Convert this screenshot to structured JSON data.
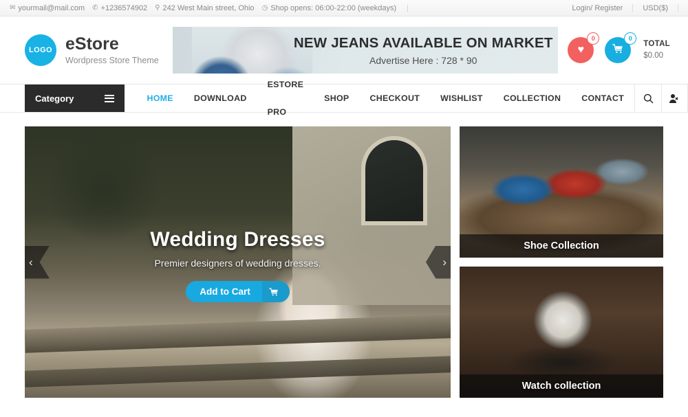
{
  "topbar": {
    "email": "yourmail@mail.com",
    "phone": "+1236574902",
    "address": "242 West Main street, Ohio",
    "hours": "Shop opens: 06:00-22:00 (weekdays)",
    "login": "Login/ Register",
    "currency": "USD($)",
    "icons": {
      "mail": "✉",
      "phone": "✆",
      "pin": "⚲",
      "clock": "◷"
    }
  },
  "header": {
    "logo_text": "LOGO",
    "brand_name": "eStore",
    "brand_tagline": "Wordpress Store Theme",
    "ad": {
      "title": "NEW JEANS AVAILABLE ON MARKET",
      "subtitle": "Advertise Here : 728 * 90"
    },
    "wishlist_count": "0",
    "cart_count": "0",
    "total_label": "TOTAL",
    "total_value": "$0.00",
    "colors": {
      "wishlist": "#f2605f",
      "cart": "#18aee0",
      "logo": "#18b2e5"
    }
  },
  "nav": {
    "category_label": "Category",
    "items": [
      {
        "label": "HOME",
        "active": true
      },
      {
        "label": "DOWNLOAD",
        "active": false
      },
      {
        "label": "ESTORE PRO",
        "active": false
      },
      {
        "label": "SHOP",
        "active": false
      },
      {
        "label": "CHECKOUT",
        "active": false
      },
      {
        "label": "WISHLIST",
        "active": false
      },
      {
        "label": "COLLECTION",
        "active": false
      },
      {
        "label": "CONTACT",
        "active": false
      }
    ],
    "active_color": "#1eb0e6"
  },
  "hero": {
    "title": "Wedding Dresses",
    "subtitle": "Premier designers of wedding dresses.",
    "button_label": "Add to Cart",
    "prev_arrow": "‹",
    "next_arrow": "›",
    "button_color": "#18a9e0"
  },
  "promos": [
    {
      "label": "Shoe Collection"
    },
    {
      "label": "Watch collection"
    }
  ]
}
